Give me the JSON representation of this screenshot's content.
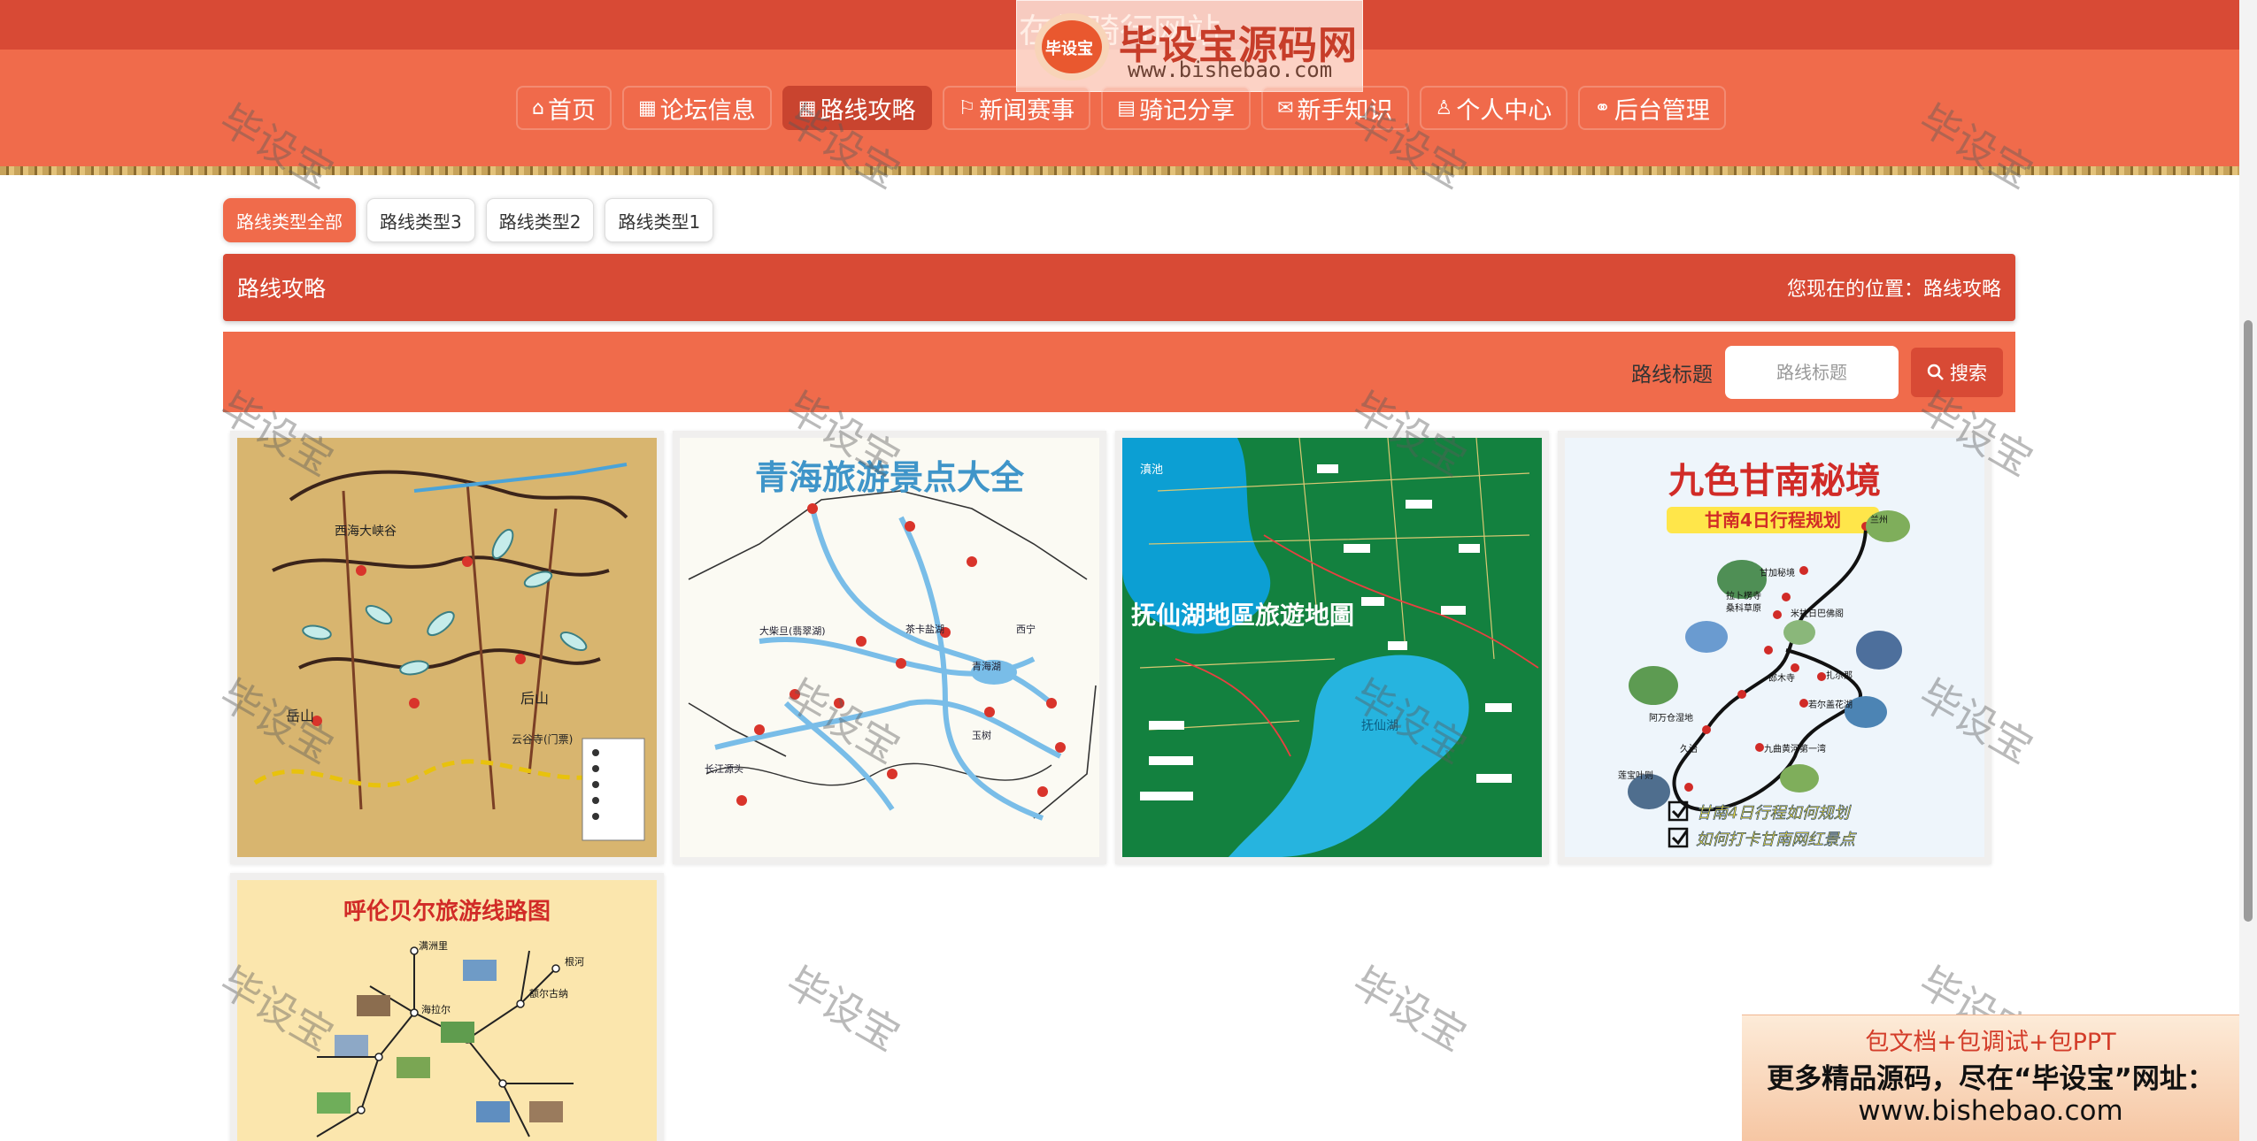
{
  "header": {
    "site_title": "在线骑行网站",
    "brand_name": "毕设宝源码网",
    "brand_url": "www.bishebao.com",
    "brand_mark": "毕设宝"
  },
  "nav": [
    {
      "label": "首页",
      "icon": "home-icon",
      "glyph": "⌂"
    },
    {
      "label": "论坛信息",
      "icon": "forum-icon",
      "glyph": "▦"
    },
    {
      "label": "路线攻略",
      "icon": "route-icon",
      "glyph": "▦"
    },
    {
      "label": "新闻赛事",
      "icon": "flag-icon",
      "glyph": "⚐"
    },
    {
      "label": "骑记分享",
      "icon": "calendar-icon",
      "glyph": "▤"
    },
    {
      "label": "新手知识",
      "icon": "mail-icon",
      "glyph": "✉"
    },
    {
      "label": "个人中心",
      "icon": "user-icon",
      "glyph": "♙"
    },
    {
      "label": "后台管理",
      "icon": "link-icon",
      "glyph": "⚭"
    }
  ],
  "filters": [
    "路线类型全部",
    "路线类型3",
    "路线类型2",
    "路线类型1"
  ],
  "title_bar": {
    "title": "路线攻略",
    "location": "您现在的位置：路线攻略"
  },
  "search": {
    "label": "路线标题",
    "placeholder": "路线标题",
    "button_label": "搜索",
    "button_icon": "search-icon"
  },
  "cards": [
    {
      "caption": "",
      "map_labels": [
        "西海大峡谷",
        "后山",
        "岳山",
        "云谷寺(门票)"
      ]
    },
    {
      "caption": "青海旅游景点大全",
      "map_labels": [
        "大柴旦(翡翠湖)",
        "茶卡盐湖",
        "青海湖",
        "玉树",
        "长江源头",
        "西宁"
      ]
    },
    {
      "caption": "抚仙湖地區旅遊地圖",
      "map_labels": [
        "滇池",
        "抚仙湖"
      ]
    },
    {
      "caption": "九色甘南秘境",
      "subtitle": "甘南4日行程规划",
      "map_labels": [
        "兰州",
        "甘加秘境",
        "拉卜楞寺",
        "桑科草原",
        "米拉日巴佛阁",
        "郎木寺",
        "扎尕那",
        "阿万仓湿地",
        "若尔盖花湖",
        "久治",
        "九曲黄河第一湾",
        "莲宝叶则"
      ],
      "checklist": [
        "甘南4日行程如何规划",
        "如何打卡甘南网红景点"
      ]
    },
    {
      "caption": "呼伦贝尔旅游线路图",
      "map_labels": [
        "满洲里",
        "海拉尔",
        "额尔古纳",
        "根河"
      ]
    }
  ],
  "watermark": "毕设宝",
  "ad": {
    "line1": "包文档+包调试+包PPT",
    "line2": "更多精品源码，尽在“毕设宝”网址：",
    "line3": "www.bishebao.com"
  },
  "colors": {
    "header": "#f06b4b",
    "header_dark": "#d84a35",
    "active": "#c9442f",
    "accent_red": "#d33c29"
  }
}
